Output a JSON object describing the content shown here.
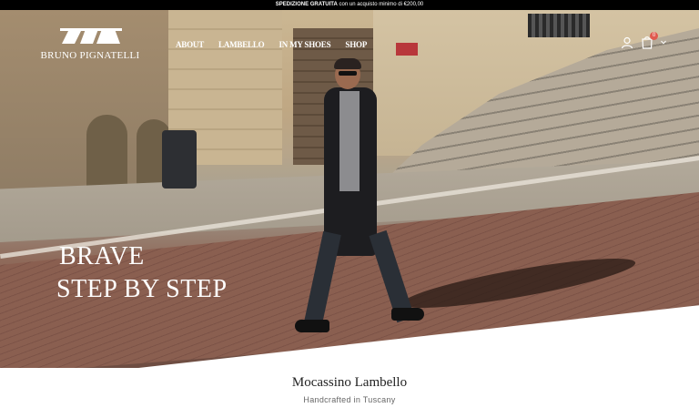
{
  "announcement": {
    "bold": "SPEDIZIONE GRATUITA",
    "rest": " con un acquisto minimo di €200,00"
  },
  "brand": {
    "name": "BRUNO PIGNATELLI",
    "logo_icon": "brand-monogram-icon"
  },
  "nav": {
    "items": [
      {
        "label": "ABOUT"
      },
      {
        "label": "LAMBELLO"
      },
      {
        "label": "IN MY SHOES"
      },
      {
        "label": "SHOP"
      }
    ]
  },
  "header_icons": {
    "account_icon": "user-icon",
    "cart_icon": "bag-icon",
    "cart_count": "0",
    "dropdown_icon": "chevron-down-icon"
  },
  "hero": {
    "headline_line1": "BRAVE",
    "headline_line2": "STEP BY STEP"
  },
  "product": {
    "title": "Mocassino Lambello",
    "subtitle": "Handcrafted in Tuscany"
  },
  "colors": {
    "topbar_bg": "#000000",
    "badge": "#e05a4f",
    "text_light": "#ffffff",
    "text_dark": "#222222"
  }
}
